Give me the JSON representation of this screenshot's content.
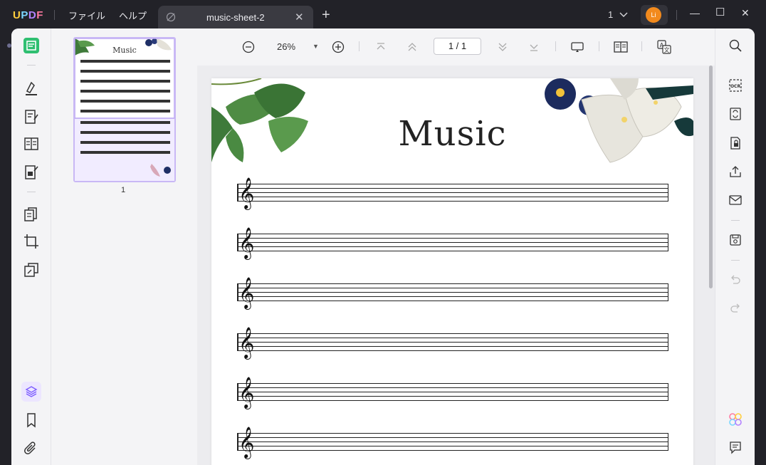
{
  "titlebar": {
    "logo": {
      "u": "U",
      "p": "P",
      "d": "D",
      "f": "F"
    },
    "menu_file": "ファイル",
    "menu_help": "ヘルプ",
    "tab_title": "music-sheet-2",
    "tab_close": "✕",
    "new_tab": "+",
    "page_count": "1",
    "avatar_initials": "Li",
    "minimize": "—",
    "maximize": "☐",
    "close": "✕"
  },
  "toolbar": {
    "zoom": "26%",
    "zoom_caret": "▼",
    "page_indicator": "1 / 1"
  },
  "thumbnails": {
    "page_label": "1",
    "thumb_title": "Music"
  },
  "document": {
    "title": "Music",
    "clef_glyph": "𝄞",
    "staff_count": 6
  },
  "colors": {
    "accent": "#7c5cff",
    "brand_green": "#2fbf71",
    "avatar": "#f28a1d"
  }
}
